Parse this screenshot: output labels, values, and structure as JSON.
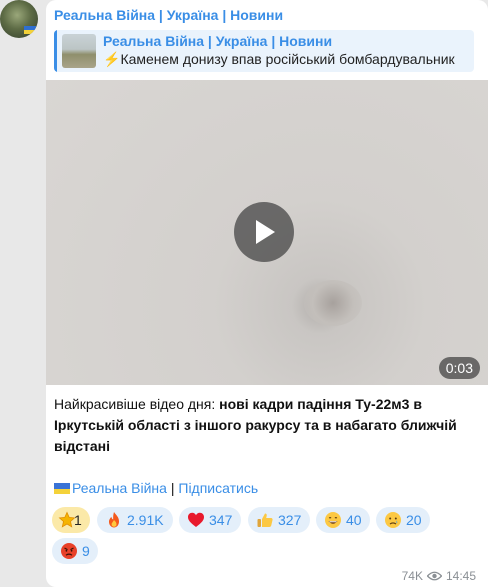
{
  "post": {
    "channel_name": "Реальна Війна | Україна | Новини",
    "reply": {
      "title": "Реальна Війна | Україна | Новини",
      "text": "Каменем донизу впав російський бомбардувальник"
    },
    "video": {
      "duration": "0:03"
    },
    "caption": {
      "lead": "Найкрасивіше відео дня: ",
      "bold": "нові кадри падіння Ту-22м3 в Іркутській області з іншого ракурсу та в набагато ближчій відстані"
    },
    "signature": {
      "channel_link": "Реальна Війна",
      "separator": " | ",
      "subscribe_link": "Підписатись"
    },
    "reactions": [
      {
        "icon": "star-emoji",
        "count": "1"
      },
      {
        "icon": "fire-emoji",
        "count": "2.91K"
      },
      {
        "icon": "heart-emoji",
        "count": "347"
      },
      {
        "icon": "thumbs-up-emoji",
        "count": "327"
      },
      {
        "icon": "grinning-face-emoji",
        "count": "40"
      },
      {
        "icon": "crying-face-emoji",
        "count": "20"
      },
      {
        "icon": "angry-face-emoji",
        "count": "9"
      }
    ],
    "views": "74K",
    "time": "14:45"
  },
  "colors": {
    "accent": "#3a8ee6",
    "bubble": "#ffffff",
    "background": "#e8e8e8",
    "reaction_bg": "#e4effa",
    "star_reaction_bg": "#fbe9a8"
  }
}
